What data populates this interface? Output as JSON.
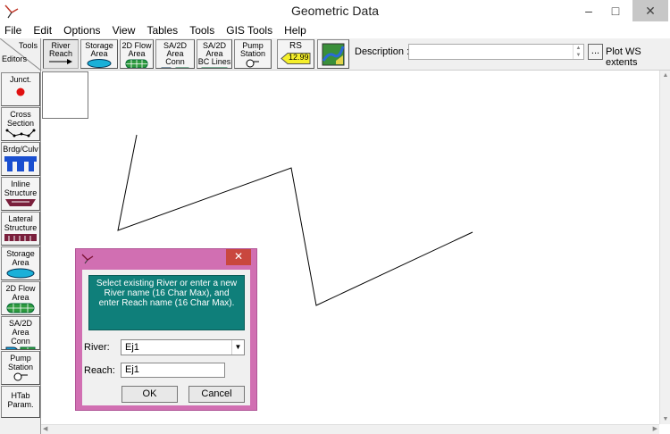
{
  "window": {
    "title": "Geometric Data",
    "min_glyph": "–",
    "max_glyph": "□",
    "close_glyph": "✕"
  },
  "menu": [
    "File",
    "Edit",
    "Options",
    "View",
    "Tables",
    "Tools",
    "GIS Tools",
    "Help"
  ],
  "toolbar": {
    "corner_tools": "Tools",
    "corner_editors": "Editors",
    "buttons": {
      "river_reach": [
        "River",
        "Reach"
      ],
      "storage_area": [
        "Storage",
        "Area"
      ],
      "flow_area_2d": [
        "2D Flow",
        "Area"
      ],
      "sa2d_conn": [
        "SA/2D Area",
        "Conn"
      ],
      "sa2d_bc": [
        "SA/2D Area",
        "BC Lines"
      ],
      "pump_station": [
        "Pump",
        "Station"
      ],
      "rs": "RS",
      "rs_value": "12.99"
    },
    "description_label": "Description :",
    "description_value": "",
    "ellipsis_label": "...",
    "plot_ws_extents": "Plot WS extents"
  },
  "editors": {
    "junct": [
      "Junct."
    ],
    "cross_section": [
      "Cross",
      "Section"
    ],
    "brdg_culv": [
      "Brdg/Culv"
    ],
    "inline_structure": [
      "Inline",
      "Structure"
    ],
    "lateral_structure": [
      "Lateral",
      "Structure"
    ],
    "storage_area": [
      "Storage",
      "Area"
    ],
    "flow_area_2d": [
      "2D Flow",
      "Area"
    ],
    "sa2d_conn": [
      "SA/2D Area",
      "Conn"
    ],
    "pump_station": [
      "Pump",
      "Station"
    ],
    "htab_param": [
      "HTab",
      "Param."
    ]
  },
  "dialog": {
    "close_glyph": "✕",
    "instruction": "Select existing River or enter a new River name (16 Char Max), and enter Reach name (16 Char Max).",
    "river_label": "River:",
    "river_value": "Ej1",
    "reach_label": "Reach:",
    "reach_value": "Ej1",
    "ok_label": "OK",
    "cancel_label": "Cancel"
  },
  "colors": {
    "dialog_frame": "#d16fb2",
    "instruction_bg": "#0f7f7a",
    "close_red": "#c9473e",
    "icon_blue": "#1a63c9"
  }
}
